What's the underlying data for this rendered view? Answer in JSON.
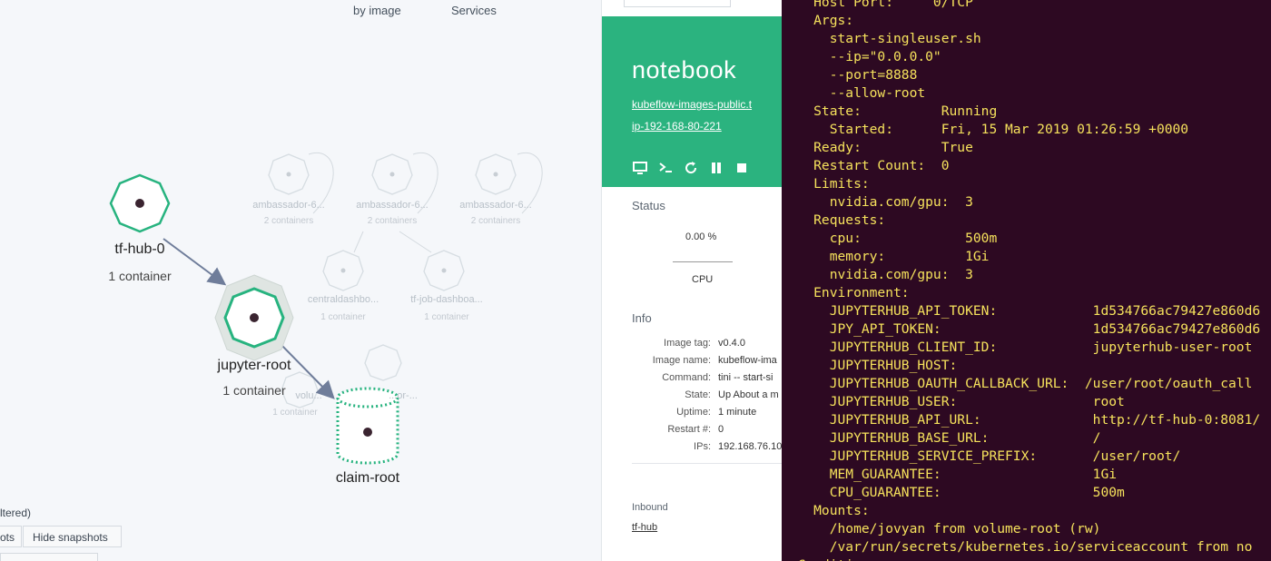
{
  "graph": {
    "top_nav": [
      "by image",
      "Services"
    ],
    "nodes": {
      "tf_hub": {
        "name": "tf-hub-0",
        "sub": "1 container"
      },
      "jupyter": {
        "name": "jupyter-root",
        "sub": "1 container"
      },
      "claim": {
        "name": "claim-root"
      }
    },
    "ghost_nodes": [
      {
        "name": "ambassador-6...",
        "sub": "2 containers"
      },
      {
        "name": "ambassador-6...",
        "sub": "2 containers"
      },
      {
        "name": "ambassador-6...",
        "sub": "2 containers"
      },
      {
        "name": "centraldashbo...",
        "sub": "1 container"
      },
      {
        "name": "tf-job-dashboa...",
        "sub": "1 container"
      },
      {
        "name": "volu...",
        "sub": "1 container"
      },
      {
        "name": "...or-..."
      }
    ],
    "filter_text": "ltered)",
    "buttons": {
      "show_snapshots": "ots",
      "hide_snapshots": "Hide snapshots"
    }
  },
  "details": {
    "title": "notebook",
    "image_link": "kubeflow-images-public.t",
    "host_link": "ip-192-168-80-221",
    "status": {
      "section": "Status",
      "cpu_value": "0.00 %",
      "cpu_label": "CPU"
    },
    "info": {
      "section": "Info",
      "rows": [
        {
          "k": "Image tag:",
          "v": "v0.4.0"
        },
        {
          "k": "Image name:",
          "v": "kubeflow-ima"
        },
        {
          "k": "Command:",
          "v": "tini -- start-si"
        },
        {
          "k": "State:",
          "v": "Up About a m"
        },
        {
          "k": "Uptime:",
          "v": "1 minute"
        },
        {
          "k": "Restart #:",
          "v": "0"
        },
        {
          "k": "IPs:",
          "v": "192.168.76.10"
        }
      ]
    },
    "inbound": {
      "section": "Inbound",
      "link": "tf-hub"
    }
  },
  "terminal": {
    "lines": [
      "    Host Port:     0/TCP",
      "    Args:",
      "      start-singleuser.sh",
      "      --ip=\"0.0.0.0\"",
      "      --port=8888",
      "      --allow-root",
      "    State:          Running",
      "      Started:      Fri, 15 Mar 2019 01:26:59 +0000",
      "    Ready:          True",
      "    Restart Count:  0",
      "    Limits:",
      "      nvidia.com/gpu:  3",
      "    Requests:",
      "      cpu:             500m",
      "      memory:          1Gi",
      "      nvidia.com/gpu:  3",
      "    Environment:",
      "      JUPYTERHUB_API_TOKEN:            1d534766ac79427e860d6",
      "      JPY_API_TOKEN:                   1d534766ac79427e860d6",
      "      JUPYTERHUB_CLIENT_ID:            jupyterhub-user-root",
      "      JUPYTERHUB_HOST:",
      "      JUPYTERHUB_OAUTH_CALLBACK_URL:  /user/root/oauth_call",
      "      JUPYTERHUB_USER:                 root",
      "      JUPYTERHUB_API_URL:              http://tf-hub-0:8081/",
      "      JUPYTERHUB_BASE_URL:             /",
      "      JUPYTERHUB_SERVICE_PREFIX:       /user/root/",
      "      MEM_GUARANTEE:                   1Gi",
      "      CPU_GUARANTEE:                   500m",
      "    Mounts:",
      "      /home/jovyan from volume-root (rw)",
      "      /var/run/secrets/kubernetes.io/serviceaccount from no",
      "  Conditions:"
    ]
  }
}
